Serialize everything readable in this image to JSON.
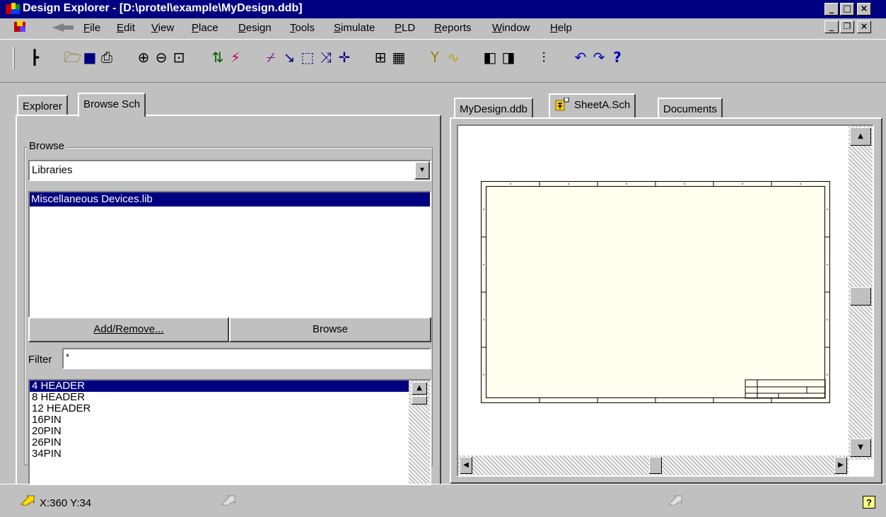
{
  "window": {
    "title": "Design Explorer - [D:\\protel\\example\\MyDesign.ddb]"
  },
  "menu": {
    "items": [
      "File",
      "Edit",
      "View",
      "Place",
      "Design",
      "Tools",
      "Simulate",
      "PLD",
      "Reports",
      "Window",
      "Help"
    ]
  },
  "left_panel": {
    "tabs": [
      "Explorer",
      "Browse Sch"
    ],
    "active_tab": "Browse Sch",
    "browse_group_label": "Browse",
    "browse_select_value": "Libraries",
    "libraries": [
      "Miscellaneous Devices.lib"
    ],
    "add_remove_label": "Add/Remove...",
    "browse_button_label": "Browse",
    "filter_label": "Filter",
    "filter_value": "*",
    "components": [
      "4 HEADER",
      "8 HEADER",
      "12 HEADER",
      "16PIN",
      "20PIN",
      "26PIN",
      "34PIN"
    ]
  },
  "right_panel": {
    "tabs": [
      "MyDesign.ddb",
      "SheetA.Sch",
      "Documents"
    ],
    "active_tab": "SheetA.Sch"
  },
  "status": {
    "coords": "X:360 Y:34"
  },
  "icons": {
    "toolbar": [
      "tree-icon",
      "open-icon",
      "save-icon",
      "print-icon",
      "zoom-in-icon",
      "zoom-out-icon",
      "zoom-fit-icon",
      "updown-icon",
      "wand-icon",
      "wire-icon",
      "line-icon",
      "select-icon",
      "deselect-icon",
      "move-icon",
      "component-icon",
      "table-icon",
      "probe-icon",
      "waveform-icon",
      "library-icon",
      "library2-icon",
      "align-icon",
      "undo-icon",
      "redo-icon",
      "help-icon"
    ]
  },
  "colors": {
    "titlebar": "#000080",
    "selection": "#000080",
    "sheet": "#fffff0"
  }
}
